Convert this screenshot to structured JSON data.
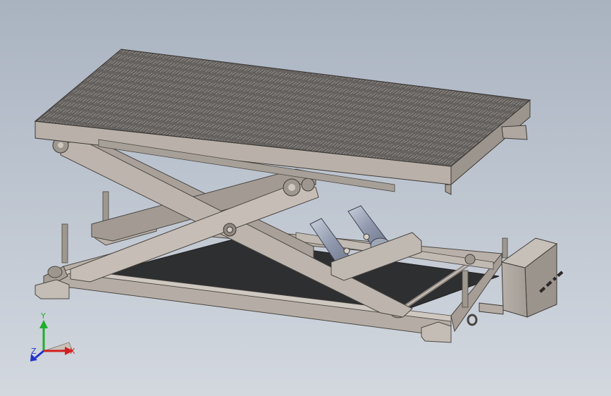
{
  "scene": {
    "background_top": "#a9b3c0",
    "background_bottom": "#d3d8df",
    "part_color": "#b9b1a9",
    "part_shadow": "#8f8880",
    "deck_color": "#5c5957",
    "base_floor_color": "#2e2f31",
    "cylinder_color": "#9aa3b8",
    "motor_box_label": "■■ ■■ ■ ■■"
  },
  "triad": {
    "x_label": "X",
    "y_label": "Y",
    "z_label": "Z",
    "x_color": "#d42020",
    "y_color": "#1fae2e",
    "z_color": "#2233cc"
  }
}
